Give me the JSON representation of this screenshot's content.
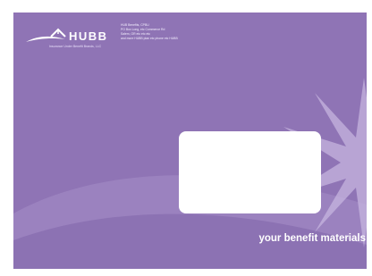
{
  "envelope": {
    "colors": {
      "background": "#8f74b5",
      "swoosh_light": "#a58ec6",
      "swoosh_dark": "#7a5fa3",
      "starburst": "#c6b4df",
      "window": "#ffffff"
    },
    "logo": {
      "wordmark": "HUBB",
      "tagline": "Insurance Under Benefit Brands, LLC",
      "icon": "house-swoosh-icon"
    },
    "address_lines": [
      "HUB Benefits, CPBU",
      "PO Box Long, etc Commerce Rd",
      "Salem, OR etc etc etc",
      "and more HUBB plan etc phone etc HUBB"
    ],
    "tagline": "your benefit materials",
    "decoration": "starburst-icon"
  }
}
